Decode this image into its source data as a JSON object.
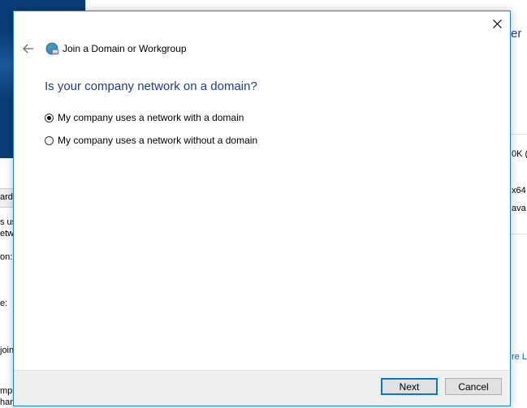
{
  "background": {
    "left_fragments": [
      "ardv",
      "s us",
      "etw",
      "on:",
      "e:",
      "join",
      "mpu",
      "hang"
    ],
    "right_fragments": [
      "er",
      "0K (",
      "x64",
      "ava",
      "re L"
    ]
  },
  "dialog": {
    "title": "Join a Domain or Workgroup",
    "question": "Is your company network on a domain?",
    "options": [
      {
        "label": "My company uses a network with a domain",
        "selected": true
      },
      {
        "label": "My company uses a network without a domain",
        "selected": false
      }
    ],
    "buttons": {
      "next": "Next",
      "cancel": "Cancel"
    }
  },
  "colors": {
    "question_blue": "#1c3d8f",
    "dialog_border": "#1883d7",
    "desktop_blue": "#0a3d78"
  },
  "icons": {
    "close": "close-icon",
    "back": "back-arrow-icon",
    "app": "network-globe-icon"
  }
}
